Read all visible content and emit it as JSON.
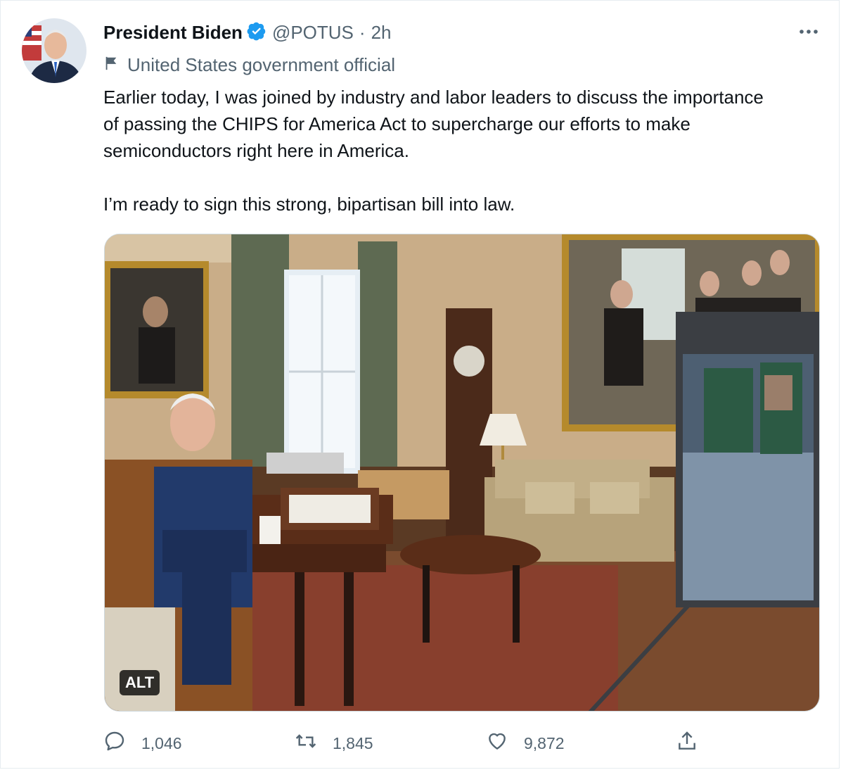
{
  "user": {
    "name": "President Biden",
    "handle": "@POTUS",
    "separator": "·",
    "time": "2h",
    "label": "United States government official"
  },
  "tweet": {
    "text": "Earlier today, I was joined by industry and labor leaders to discuss the importance\nof passing the CHIPS for America Act to supercharge our efforts to make\nsemiconductors right here in America.\n\nI’m ready to sign this strong, bipartisan bill into law."
  },
  "media": {
    "alt_badge": "ALT"
  },
  "actions": {
    "replies": "1,046",
    "retweets": "1,845",
    "likes": "9,872"
  },
  "colors": {
    "text": "#0f1419",
    "secondary": "#536471",
    "verified": "#1d9bf0",
    "border": "#cfd9de"
  },
  "icons": [
    "verified-badge-icon",
    "more-options-icon",
    "flag-icon",
    "reply-icon",
    "retweet-icon",
    "like-icon",
    "share-icon"
  ]
}
